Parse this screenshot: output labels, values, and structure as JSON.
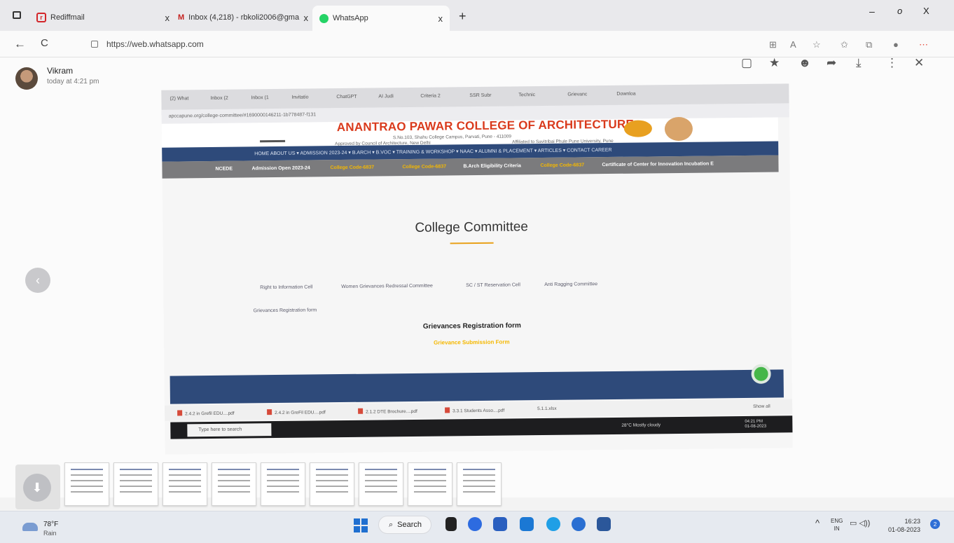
{
  "browser": {
    "tabs": [
      {
        "title": "Rediffmail",
        "close": "x"
      },
      {
        "title": "Inbox (4,218) - rbkoli2006@gma",
        "close": "x"
      },
      {
        "title": "WhatsApp",
        "close": "x"
      }
    ],
    "new_tab": "+",
    "window_controls": {
      "minimize": "–",
      "restore": "o",
      "close": "X"
    },
    "url": "https://web.whatsapp.com",
    "nav": {
      "back": "←",
      "reload": "C"
    }
  },
  "viewer": {
    "sender": "Vikram",
    "time": "today at 4:21 pm",
    "icons": [
      "message-icon",
      "star-icon",
      "sticker-icon",
      "forward-icon",
      "download-icon",
      "more-icon",
      "close-icon"
    ],
    "prev": "‹",
    "download": "⬇"
  },
  "photo": {
    "inner_tabs": [
      "(2) What",
      "Inbox (2",
      "Inbox (1",
      "Invitatio",
      "ChatGPT",
      "AI Judi",
      "Criteria 2",
      "SSR Subr",
      "Technic",
      "Grievanc",
      "Downloa"
    ],
    "inner_url": "apccapune.org/college-committee/#1690000146211-1b778487-f131",
    "college_name": "ANANTRAO PAWAR COLLEGE OF ARCHITECTURE",
    "address": "S.No.103, Shahu College Campus, Parvati, Pune - 411009",
    "approved": "Approved by Council of Architecture, New Delhi",
    "affiliated": "Affiliated to Savitribai Phule Pune University, Pune",
    "nav_menu": "HOME  ABOUT US ▾  ADMISSION 2023-24 ▾  B.ARCH ▾  B.VOC ▾  TRAINING & WORKSHOP ▾  NAAC ▾  ALUMNI & PLACEMENT ▾  ARTICLES ▾  CONTACT  CAREER",
    "ticker": [
      "NCEDE",
      "Admission Open 2023-24",
      "College Code-6837",
      "College Code-6837",
      "B.Arch Eligibility Criteria",
      "College Code-6837",
      "Certificate of Center for Innovation Incubation E"
    ],
    "page_title": "College Committee",
    "committees": [
      "Right to Information Cell",
      "Women Grievances Redressal Committee",
      "SC / ST Reservation Cell",
      "Anti Ragging Committee"
    ],
    "grievance_link": "Grievances Registration form",
    "grievance_heading": "Grievances Registration form",
    "grievance_sub": "Grievance Submission Form",
    "downloads": [
      "2.4.2 in Grefil EDU....pdf",
      "2.4.2 in GreFil EDU....pdf",
      "2.1.2 DTE Brochure....pdf",
      "3.3.1 Students Asso....pdf",
      "5.1.1.xlsx"
    ],
    "downloads_showall": "Show all",
    "taskbar_search": "Type here to search",
    "weather": "28°C  Mostly cloudy",
    "clock": [
      "04:21 PM",
      "01-08-2023"
    ]
  },
  "thumbnails_count": 9,
  "taskbar": {
    "temperature": "78°F",
    "condition": "Rain",
    "search": "Search",
    "lang_top": "ENG",
    "lang_bottom": "IN",
    "time": "16:23",
    "date": "01-08-2023",
    "notifications": "2"
  }
}
